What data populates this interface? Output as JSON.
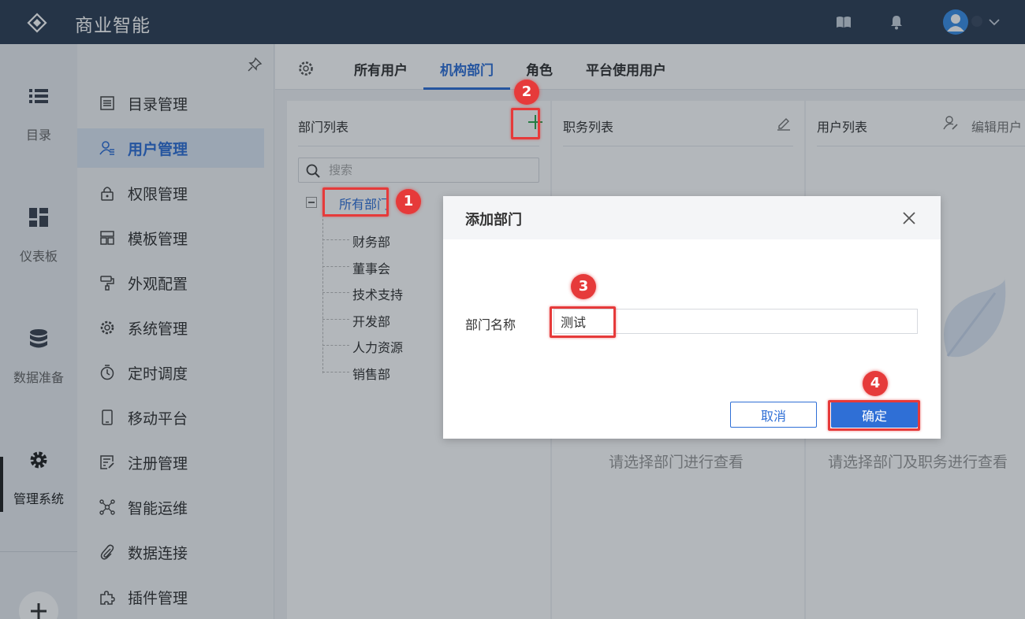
{
  "app": {
    "title": "商业智能"
  },
  "rail": {
    "items": [
      {
        "label": "目录",
        "icon": "list-icon"
      },
      {
        "label": "仪表板",
        "icon": "dashboard-icon"
      },
      {
        "label": "数据准备",
        "icon": "database-icon"
      },
      {
        "label": "管理系统",
        "icon": "gear-icon",
        "active": true
      }
    ],
    "add_icon": "plus-icon"
  },
  "submenu": {
    "items": [
      {
        "label": "目录管理",
        "icon": "catalog-icon"
      },
      {
        "label": "用户管理",
        "icon": "user-manage-icon",
        "active": true
      },
      {
        "label": "权限管理",
        "icon": "lock-icon"
      },
      {
        "label": "模板管理",
        "icon": "template-icon"
      },
      {
        "label": "外观配置",
        "icon": "paint-roller-icon"
      },
      {
        "label": "系统管理",
        "icon": "settings-icon"
      },
      {
        "label": "定时调度",
        "icon": "timer-icon"
      },
      {
        "label": "移动平台",
        "icon": "mobile-icon"
      },
      {
        "label": "注册管理",
        "icon": "register-icon"
      },
      {
        "label": "智能运维",
        "icon": "network-icon"
      },
      {
        "label": "数据连接",
        "icon": "paperclip-icon"
      },
      {
        "label": "插件管理",
        "icon": "puzzle-icon"
      }
    ]
  },
  "tabs": {
    "items": [
      {
        "label": "所有用户"
      },
      {
        "label": "机构部门",
        "active": true
      },
      {
        "label": "角色"
      },
      {
        "label": "平台使用用户"
      }
    ]
  },
  "dept_panel": {
    "title": "部门列表",
    "search_placeholder": "搜索",
    "root": "所有部门",
    "children": [
      "财务部",
      "董事会",
      "技术支持",
      "开发部",
      "人力资源",
      "销售部"
    ]
  },
  "post_panel": {
    "title": "职务列表",
    "empty": "请选择部门进行查看"
  },
  "user_panel": {
    "title": "用户列表",
    "edit_label": "编辑用户",
    "empty": "请选择部门及职务进行查看"
  },
  "dialog": {
    "title": "添加部门",
    "field_label": "部门名称",
    "field_value": "测试",
    "cancel_label": "取消",
    "ok_label": "确定"
  },
  "callouts": [
    "1",
    "2",
    "3",
    "4"
  ],
  "colors": {
    "accent": "#2f6fd6",
    "topbar": "#2f3e54",
    "callout": "#e63a3a",
    "add_icon": "#2fa84f"
  }
}
